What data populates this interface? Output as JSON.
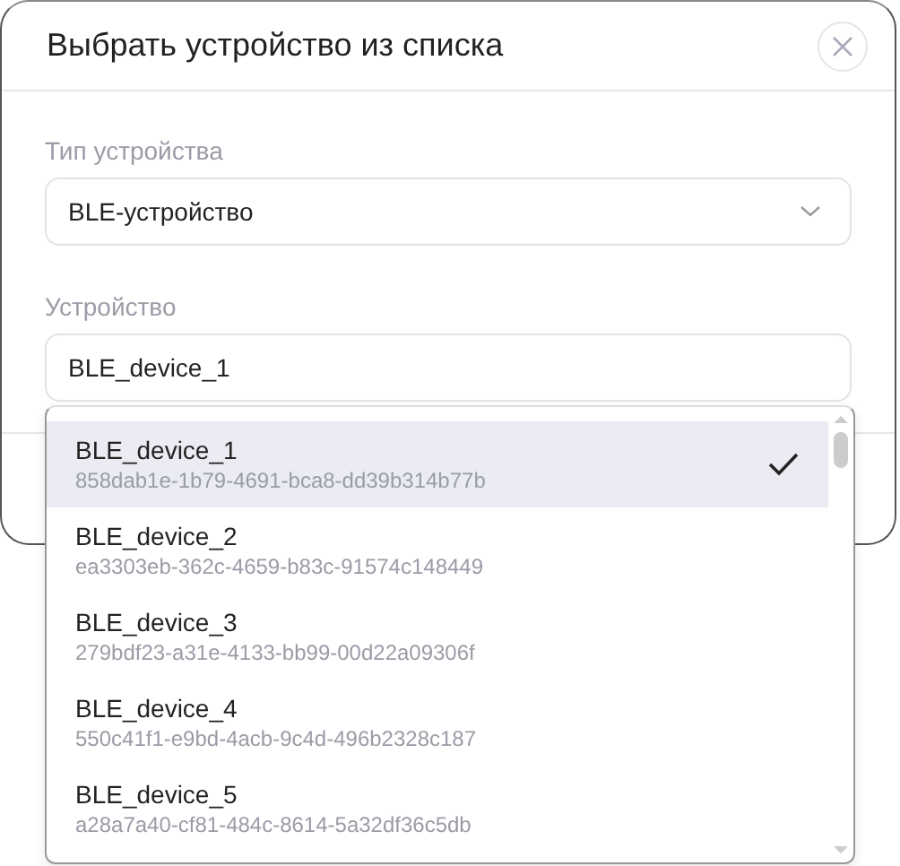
{
  "dialog": {
    "title": "Выбрать устройство из списка"
  },
  "device_type": {
    "label": "Тип устройства",
    "value": "BLE-устройство"
  },
  "device": {
    "label": "Устройство",
    "value": "BLE_device_1"
  },
  "options": [
    {
      "name": "BLE_device_1",
      "id": "858dab1e-1b79-4691-bca8-dd39b314b77b",
      "selected": true
    },
    {
      "name": "BLE_device_2",
      "id": "ea3303eb-362c-4659-b83c-91574c148449",
      "selected": false
    },
    {
      "name": "BLE_device_3",
      "id": "279bdf23-a31e-4133-bb99-00d22a09306f",
      "selected": false
    },
    {
      "name": "BLE_device_4",
      "id": "550c41f1-e9bd-4acb-9c4d-496b2328c187",
      "selected": false
    },
    {
      "name": "BLE_device_5",
      "id": "a28a7a40-cf81-484c-8614-5a32df36c5db",
      "selected": false
    }
  ]
}
